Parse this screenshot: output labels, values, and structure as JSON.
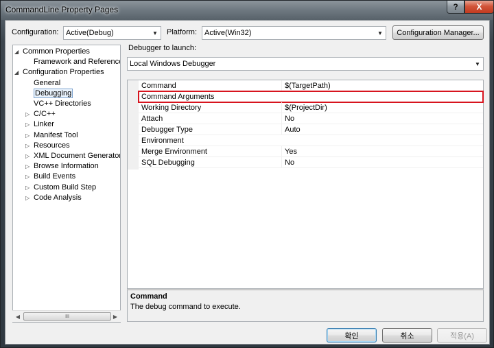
{
  "window": {
    "title": "CommandLine Property Pages",
    "help_label": "?",
    "close_label": "X"
  },
  "toolbar": {
    "configuration_label": "Configuration:",
    "configuration_value": "Active(Debug)",
    "platform_label": "Platform:",
    "platform_value": "Active(Win32)",
    "config_manager_label": "Configuration Manager..."
  },
  "tree": {
    "items": [
      {
        "label": "Common Properties",
        "level": 0,
        "expanded": true
      },
      {
        "label": "Framework and References",
        "level": 1
      },
      {
        "label": "Configuration Properties",
        "level": 0,
        "expanded": true
      },
      {
        "label": "General",
        "level": 1
      },
      {
        "label": "Debugging",
        "level": 1,
        "selected": true
      },
      {
        "label": "VC++ Directories",
        "level": 1
      },
      {
        "label": "C/C++",
        "level": 1,
        "collapsed": true
      },
      {
        "label": "Linker",
        "level": 1,
        "collapsed": true
      },
      {
        "label": "Manifest Tool",
        "level": 1,
        "collapsed": true
      },
      {
        "label": "Resources",
        "level": 1,
        "collapsed": true
      },
      {
        "label": "XML Document Generator",
        "level": 1,
        "collapsed": true
      },
      {
        "label": "Browse Information",
        "level": 1,
        "collapsed": true
      },
      {
        "label": "Build Events",
        "level": 1,
        "collapsed": true
      },
      {
        "label": "Custom Build Step",
        "level": 1,
        "collapsed": true
      },
      {
        "label": "Code Analysis",
        "level": 1,
        "collapsed": true
      }
    ],
    "scroll_thumb_glyph": "III"
  },
  "debugger": {
    "label": "Debugger to launch:",
    "value": "Local Windows Debugger"
  },
  "properties": [
    {
      "name": "Command",
      "value": "$(TargetPath)"
    },
    {
      "name": "Command Arguments",
      "value": "",
      "highlighted": true
    },
    {
      "name": "Working Directory",
      "value": "$(ProjectDir)"
    },
    {
      "name": "Attach",
      "value": "No"
    },
    {
      "name": "Debugger Type",
      "value": "Auto"
    },
    {
      "name": "Environment",
      "value": ""
    },
    {
      "name": "Merge Environment",
      "value": "Yes"
    },
    {
      "name": "SQL Debugging",
      "value": "No"
    }
  ],
  "description": {
    "title": "Command",
    "text": "The debug command to execute."
  },
  "buttons": {
    "ok": "확인",
    "cancel": "취소",
    "apply": "적용(A)"
  },
  "colors": {
    "highlight_border": "#d7141e",
    "selection_border": "#7da2ce"
  }
}
